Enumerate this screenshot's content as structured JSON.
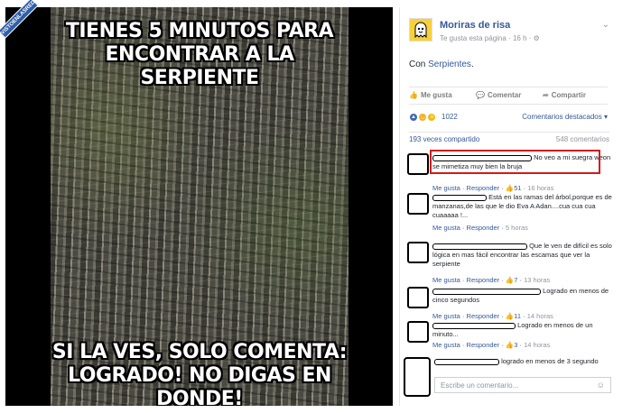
{
  "watermark": "VISTOENLASREDES .COM",
  "meme": {
    "top_line1": "TIENES 5 MINUTOS PARA",
    "top_line2": "ENCONTRAR A LA SERPIENTE",
    "bottom_line1": "SI LA VES, SOLO COMENTA:",
    "bottom_line2": "LOGRADO! NO DIGAS EN DONDE!"
  },
  "post": {
    "page_name": "Moriras de risa",
    "meta": "Te gusta esta página · 16 h · ⚙",
    "text_prefix": "Con ",
    "text_link": "Serpientes",
    "text_suffix": ".",
    "actions": {
      "like": "Me gusta",
      "comment": "Comentar",
      "share": "Compartir"
    },
    "reaction_count": "1022",
    "sort_label": "Comentarios destacados ▾",
    "shares": "193 veces compartido",
    "comments_count": "548 comentarios"
  },
  "comments": [
    {
      "text": "No veo a mi suegra weon se mimetiza muy bien la bruja",
      "likes": "51",
      "time": "16 horas"
    },
    {
      "text": "Está en las ramas del árbol,porque es de manzanas,de las que le dio Eva A Adan....cua cua cua cuaaaaa !...",
      "likes": "",
      "time": "5 horas"
    },
    {
      "text": "Que le ven de difícil es solo lógica en mas fácil encontrar las escamas que ver la serpiente",
      "likes": "7",
      "time": "13 horas"
    },
    {
      "text": "Logrado en menos de cinco segundos",
      "likes": "11",
      "time": "14 horas"
    },
    {
      "text": "Logrado en menos de un minuto...",
      "likes": "3",
      "time": "14 horas"
    },
    {
      "text": "logrado en menos de 3 segundo",
      "likes": "",
      "time": ""
    }
  ],
  "comment_actions": {
    "like": "Me gusta",
    "reply": "Responder"
  },
  "composer": {
    "placeholder": "Escribe un comentario..."
  }
}
